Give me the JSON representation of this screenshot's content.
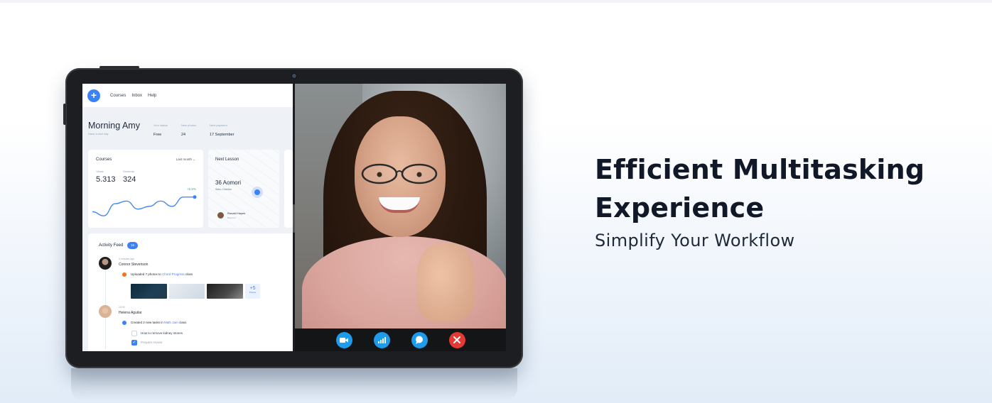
{
  "hero": {
    "headline_line1": "Efficient Multitasking",
    "headline_line2": "Experience",
    "subheadline": "Simplify Your Workflow"
  },
  "app": {
    "nav": [
      "Courses",
      "Inbox",
      "Help"
    ],
    "greeting": "Morning Amy",
    "greeting_sub": "Have a nice day",
    "stats": [
      {
        "label": "Your status",
        "value": "Free"
      },
      {
        "label": "New photos",
        "value": "24"
      },
      {
        "label": "Next payment",
        "value": "17 September"
      }
    ],
    "courses_card": {
      "title": "Courses",
      "period": "Last month",
      "views_label": "Views",
      "views_value": "5.313",
      "students_label": "Students",
      "students_value": "324",
      "growth": "+5.5%",
      "chart_line": [
        52,
        58,
        40,
        36,
        48,
        44,
        36,
        44,
        30,
        30
      ]
    },
    "lesson_card": {
      "title": "Next Lesson",
      "place": "36 Aomori",
      "address": "Sebu-Chichibu",
      "teacher_name": "Ronald Hayes",
      "teacher_role": "Beginner"
    },
    "feed": {
      "title": "Activity Feed",
      "badge": "16",
      "entries": [
        {
          "time": "3 minutes ago",
          "name": "Connor Stevenson",
          "action": "Uploaded 7 photos to",
          "target": "Chord Progress",
          "suffix": "class"
        },
        {
          "time": "10:00",
          "name": "Helena Aguilar",
          "action": "Created 2 new tasks in",
          "target": "Math Jam",
          "suffix": "class"
        }
      ],
      "more_photos": "+5",
      "more_photos_label": "Photos",
      "tasks": [
        {
          "label": "How to remove kidney stones",
          "checked": false
        },
        {
          "label": "Prepare review",
          "checked": true
        }
      ]
    }
  },
  "call_controls": [
    {
      "name": "video-camera",
      "color": "#1e9be9"
    },
    {
      "name": "signal",
      "color": "#1e9be9"
    },
    {
      "name": "chat",
      "color": "#1e9be9"
    },
    {
      "name": "end-call",
      "color": "#e53935"
    }
  ]
}
